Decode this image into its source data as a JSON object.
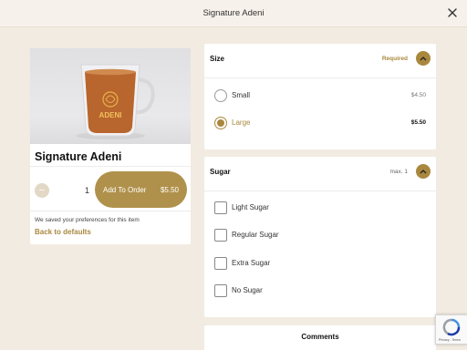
{
  "header": {
    "title": "Signature Adeni"
  },
  "product": {
    "name": "Signature Adeni",
    "logo_text": "ADENI",
    "quantity": "1",
    "minus": "−",
    "plus": "+",
    "add_label": "Add To Order",
    "add_price": "$5.50",
    "saved_note": "We saved your preferences for this item",
    "back_label": "Back to defaults"
  },
  "size": {
    "title": "Size",
    "tag": "Required",
    "options": [
      {
        "label": "Small",
        "price": "$4.50",
        "selected": false
      },
      {
        "label": "Large",
        "price": "$5.50",
        "selected": true
      }
    ]
  },
  "sugar": {
    "title": "Sugar",
    "tag": "max. 1",
    "options": [
      {
        "label": "Light Sugar"
      },
      {
        "label": "Regular Sugar"
      },
      {
        "label": "Extra Sugar"
      },
      {
        "label": "No Sugar"
      }
    ]
  },
  "comments": {
    "title": "Comments"
  },
  "recaptcha": {
    "links": "Privacy - Terms"
  },
  "colors": {
    "accent": "#a9883e",
    "button": "#b0914b",
    "page_bg": "#f2ebe1"
  }
}
